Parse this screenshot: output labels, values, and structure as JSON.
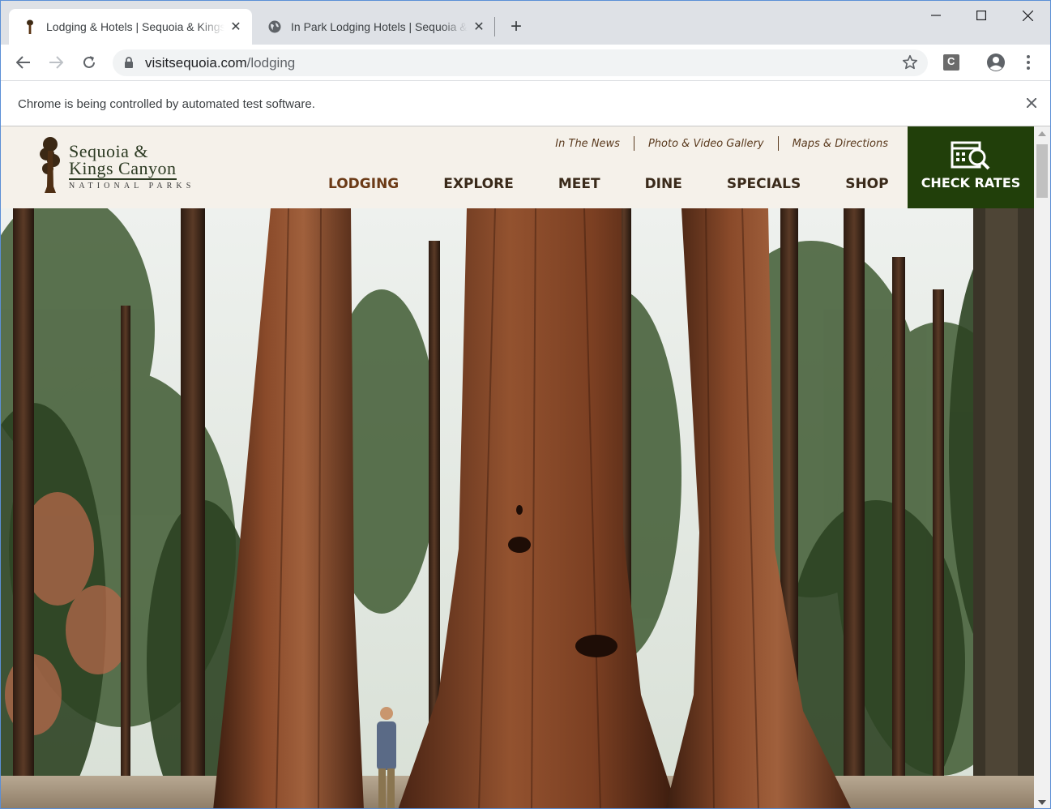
{
  "browser": {
    "tabs": [
      {
        "title": "Lodging & Hotels | Sequoia & Kings Canyon",
        "icon": "sequoia-tree-favicon"
      },
      {
        "title": "In Park Lodging Hotels | Sequoia & Kings Canyon",
        "icon": "globe-icon"
      }
    ],
    "new_tab": "+",
    "address": {
      "domain": "visitsequoia.com",
      "path": "/lodging"
    },
    "extension_letter": "C",
    "infobar_message": "Chrome is being controlled by automated test software."
  },
  "site": {
    "logo": {
      "line1": "Sequoia &",
      "line2": "Kings Canyon",
      "line3": "NATIONAL PARKS"
    },
    "utility_links": [
      "In The News",
      "Photo & Video Gallery",
      "Maps & Directions"
    ],
    "nav": [
      "LODGING",
      "EXPLORE",
      "MEET",
      "DINE",
      "SPECIALS",
      "SHOP"
    ],
    "check_rates": "CHECK RATES",
    "colors": {
      "header_bg": "#f5f1ea",
      "cta_bg": "#213f0a",
      "nav_text": "#3a2a1a",
      "current_nav": "#6b3a16"
    }
  }
}
